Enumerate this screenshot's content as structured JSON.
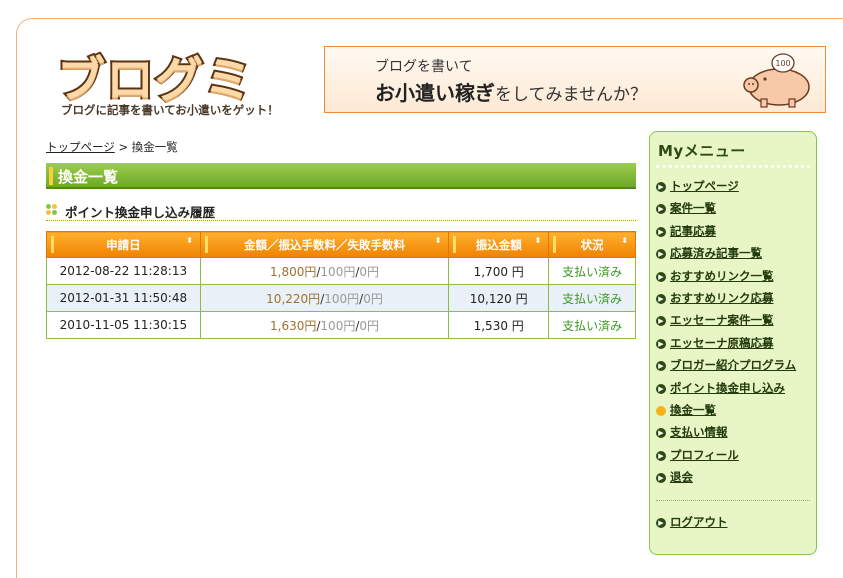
{
  "header": {
    "logo_text": "ブログミ",
    "logo_tagline": "ブログに記事を書いてお小遣いをゲット！",
    "banner_line1": "ブログを書いて",
    "banner_strong": "お小遣い稼ぎ",
    "banner_rest": "をしてみませんか？",
    "pig_badge": "100"
  },
  "breadcrumb": {
    "home": "トップページ",
    "separator": ">",
    "current": "換金一覧"
  },
  "page_title": "換金一覧",
  "section_title": "ポイント換金申し込み履歴",
  "table": {
    "columns": [
      "申請日",
      "金額／振込手数料／失敗手数料",
      "振込金額",
      "状況"
    ],
    "sort_glyph": "⬍",
    "rows": [
      {
        "date": "2012-08-22 11:28:13",
        "amount": "1,800",
        "fee": "100",
        "fail_fee": "0",
        "transfer": "1,700",
        "status": "支払い済み"
      },
      {
        "date": "2012-01-31 11:50:48",
        "amount": "10,220",
        "fee": "100",
        "fail_fee": "0",
        "transfer": "10,120",
        "status": "支払い済み"
      },
      {
        "date": "2010-11-05 11:30:15",
        "amount": "1,630",
        "fee": "100",
        "fail_fee": "0",
        "transfer": "1,530",
        "status": "支払い済み"
      }
    ],
    "yen": "円",
    "slash": "/"
  },
  "menu": {
    "title": "Myメニュー",
    "items": [
      "トップページ",
      "案件一覧",
      "記事応募",
      "応募済み記事一覧",
      "おすすめリンク一覧",
      "おすすめリンク応募",
      "エッセーナ案件一覧",
      "エッセーナ原稿応募",
      "ブロガー紹介プログラム",
      "ポイント換金申し込み",
      "換金一覧",
      "支払い情報",
      "プロフィール",
      "退会"
    ],
    "current_index": 10,
    "logout": "ログアウト"
  },
  "colors": {
    "accent_orange": "#f08200",
    "accent_green": "#6ea72a",
    "menu_bg": "#e8f6c6",
    "status_green": "#3c9a22"
  }
}
